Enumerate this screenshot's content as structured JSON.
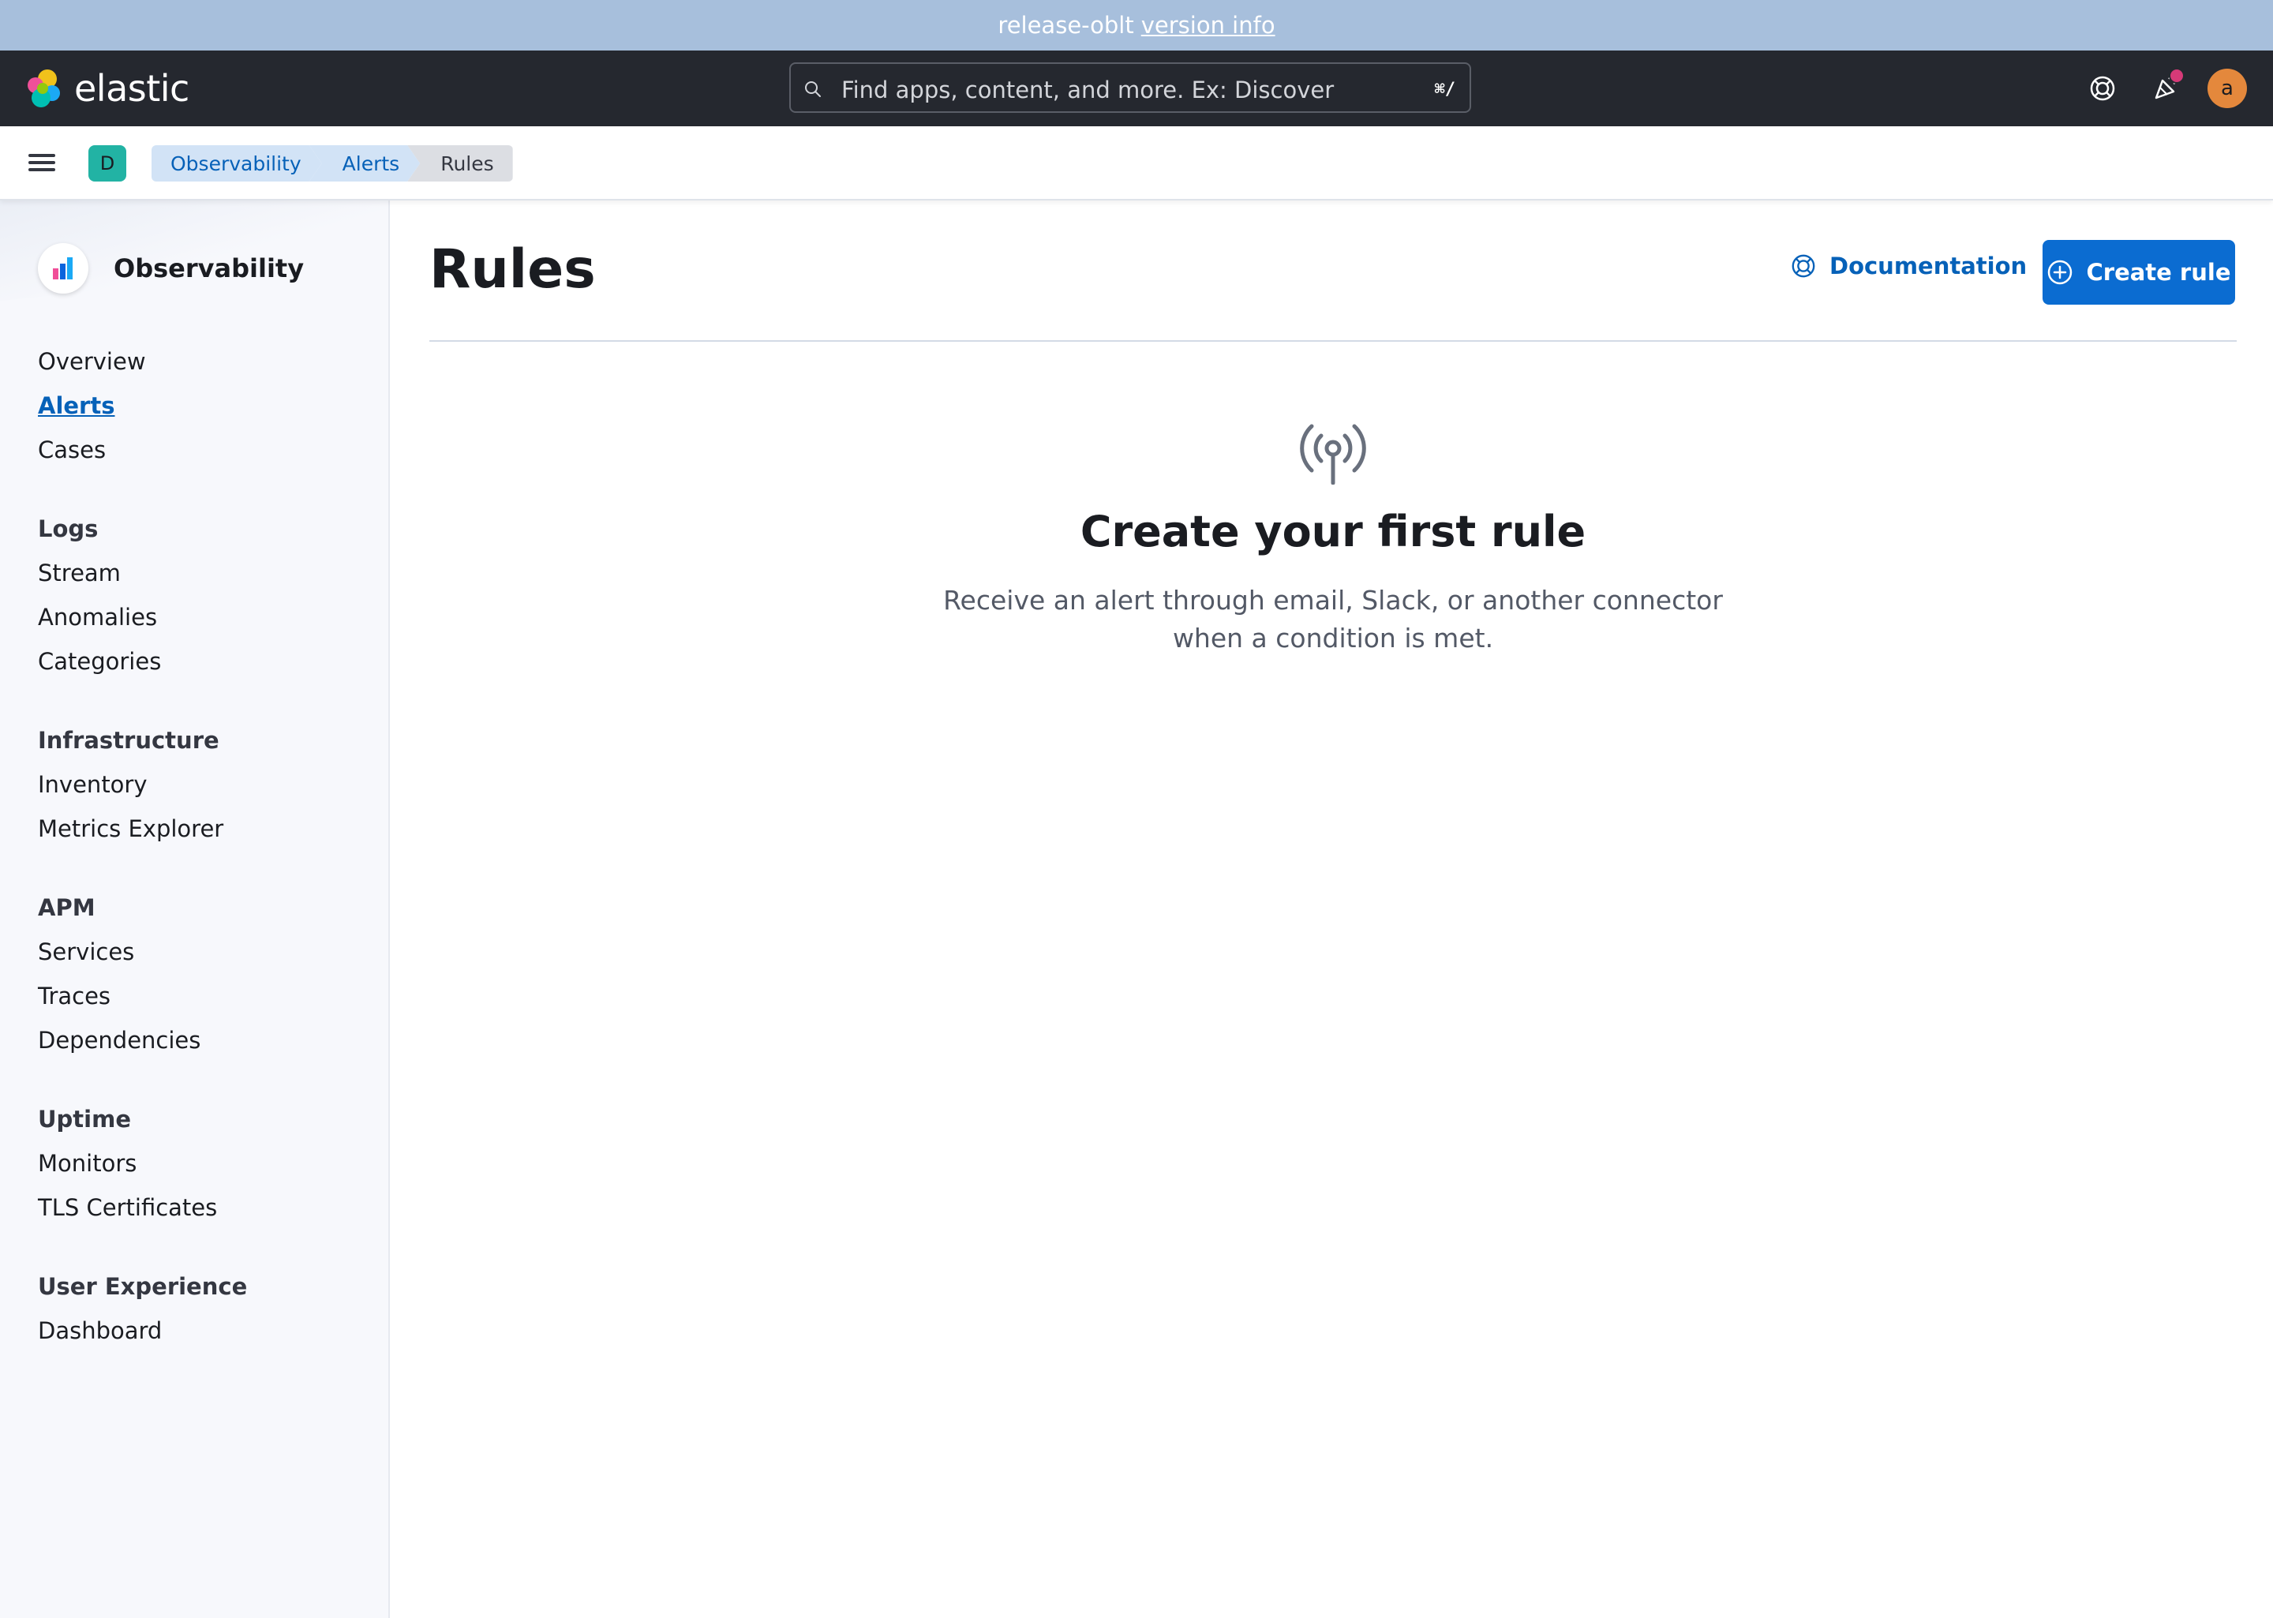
{
  "banner": {
    "text": "release-oblt",
    "link": "version info"
  },
  "header": {
    "brand": "elastic",
    "search": {
      "placeholder": "Find apps, content, and more. Ex: Discover",
      "shortcut": "⌘/"
    },
    "avatar_initial": "a",
    "icons": [
      "help-icon",
      "newsfeed-icon"
    ]
  },
  "breadcrumbs": {
    "space_initial": "D",
    "items": [
      "Observability",
      "Alerts",
      "Rules"
    ]
  },
  "sidebar": {
    "app_title": "Observability",
    "top_items": [
      "Overview",
      "Alerts",
      "Cases"
    ],
    "active_item": "Alerts",
    "groups": [
      {
        "title": "Logs",
        "items": [
          "Stream",
          "Anomalies",
          "Categories"
        ]
      },
      {
        "title": "Infrastructure",
        "items": [
          "Inventory",
          "Metrics Explorer"
        ]
      },
      {
        "title": "APM",
        "items": [
          "Services",
          "Traces",
          "Dependencies"
        ]
      },
      {
        "title": "Uptime",
        "items": [
          "Monitors",
          "TLS Certificates"
        ]
      },
      {
        "title": "User Experience",
        "items": [
          "Dashboard"
        ]
      }
    ]
  },
  "main": {
    "title": "Rules",
    "documentation_label": "Documentation",
    "create_rule_label": "Create rule",
    "empty_state": {
      "title": "Create your first rule",
      "body": "Receive an alert through email, Slack, or another connector when a condition is met."
    }
  },
  "colors": {
    "banner": "#a7bfdc",
    "header": "#25282f",
    "primary": "#0b6cd1",
    "link": "#0661b8",
    "space_badge": "#22b3a4",
    "avatar": "#e4883c",
    "notification_dot": "#d63a78"
  }
}
